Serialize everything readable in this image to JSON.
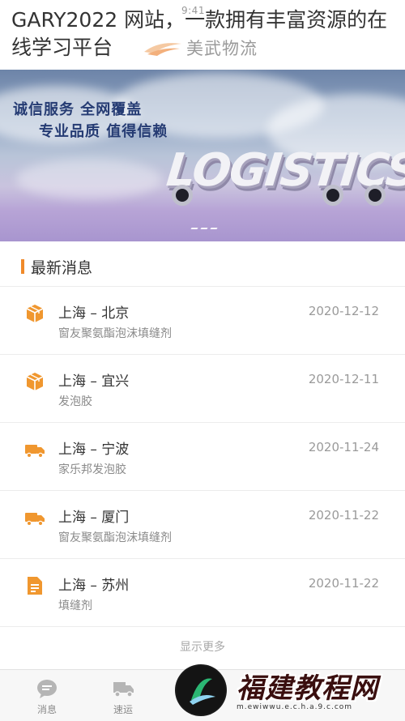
{
  "header": {
    "status_time": "9:41",
    "overlay_title": "GARY2022 网站，一款拥有丰富资源的在线学习平台",
    "brand_name": "美武物流"
  },
  "banner": {
    "line1": "诚信服务  全网覆盖",
    "line2": "专业品质  值得信赖",
    "word": "LOGISTICS"
  },
  "news": {
    "title": "最新消息",
    "items": [
      {
        "route": "上海 – 北京",
        "desc": "窗友聚氨酯泡沫填缝剂",
        "date": "2020-12-12",
        "icon": "package-icon"
      },
      {
        "route": "上海 – 宜兴",
        "desc": "发泡胶",
        "date": "2020-12-11",
        "icon": "package-icon"
      },
      {
        "route": "上海 – 宁波",
        "desc": "家乐邦发泡胶",
        "date": "2020-11-24",
        "icon": "truck-icon"
      },
      {
        "route": "上海 – 厦门",
        "desc": "窗友聚氨酯泡沫填缝剂",
        "date": "2020-11-22",
        "icon": "truck-icon"
      },
      {
        "route": "上海 – 苏州",
        "desc": "填缝剂",
        "date": "2020-11-22",
        "icon": "document-icon"
      }
    ],
    "show_more": "显示更多"
  },
  "tabbar": {
    "tabs": [
      {
        "label": "消息",
        "icon": "message-icon"
      },
      {
        "label": "速运",
        "icon": "truck-icon"
      }
    ]
  },
  "watermark": {
    "text": "福建教程网",
    "url": "m.ewiwwu.e.c.h.a.9.c.com"
  },
  "colors": {
    "accent": "#f08a2a",
    "banner_text": "#253b73"
  }
}
